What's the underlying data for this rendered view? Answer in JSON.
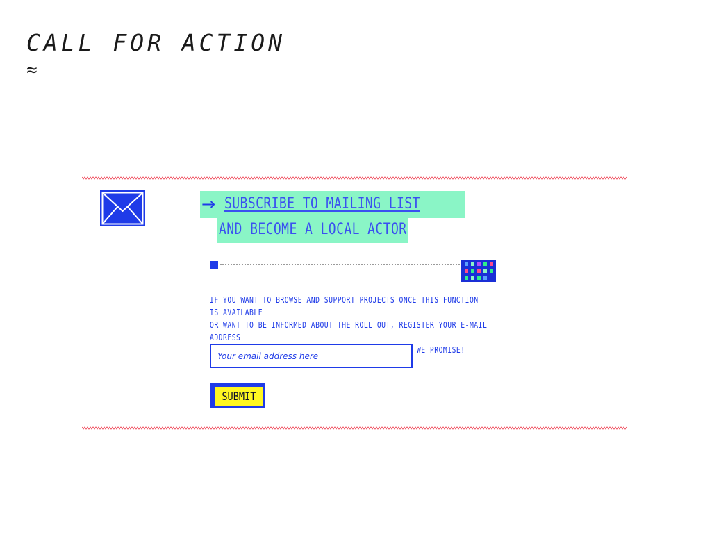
{
  "header": {
    "title": "CALL FOR ACTION",
    "symbol": "≈"
  },
  "section": {
    "icon": "envelope-icon",
    "arrow": "→",
    "link_text": "SUBSCRIBE TO MAILING LIST",
    "subheadline": "AND BECOME A LOCAL ACTOR",
    "progress_icons": [
      "progress-start-marker",
      "pixel-grid-icon"
    ],
    "description_lines": [
      "IF YOU WANT TO BROWSE AND SUPPORT PROJECTS ONCE THIS FUNCTION IS AVAILABLE",
      "OR WANT TO BE INFORMED ABOUT THE ROLL OUT, REGISTER YOUR E-MAIL ADDRESS",
      "AND WAIT FOR THE NEXT STEPS. MORE TO COME SOON WE PROMISE!"
    ],
    "email_placeholder": "Your email address here",
    "email_value": "",
    "submit_label": "SUBMIT"
  },
  "colors": {
    "blue": "#1f3be8",
    "mint": "#8af5c6",
    "yellow": "#fff722",
    "wavy_red": "#f04a5a"
  }
}
